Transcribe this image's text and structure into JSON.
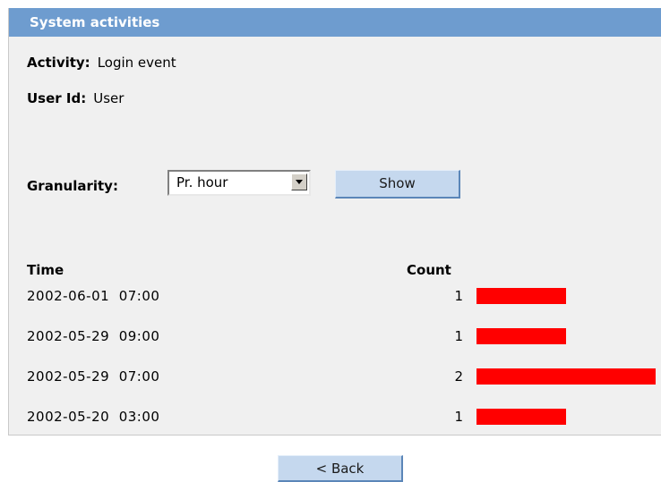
{
  "panel": {
    "title": "System activities",
    "activity_label": "Activity:",
    "activity_value": "Login event",
    "userid_label": "User Id:",
    "userid_value": "User",
    "granularity_label": "Granularity:",
    "granularity_selected": "Pr. hour",
    "show_label": "Show"
  },
  "table": {
    "headers": {
      "time": "Time",
      "count": "Count"
    },
    "max_count": 2,
    "rows": [
      {
        "time": "2002-06-01  07:00",
        "count": 1
      },
      {
        "time": "2002-05-29  09:00",
        "count": 1
      },
      {
        "time": "2002-05-29  07:00",
        "count": 2
      },
      {
        "time": "2002-05-20  03:00",
        "count": 1
      }
    ]
  },
  "footer": {
    "back_label": "< Back"
  },
  "colors": {
    "header_bg": "#6e9ccf",
    "bar": "#ff0000",
    "button_bg": "#c5d8ee"
  }
}
